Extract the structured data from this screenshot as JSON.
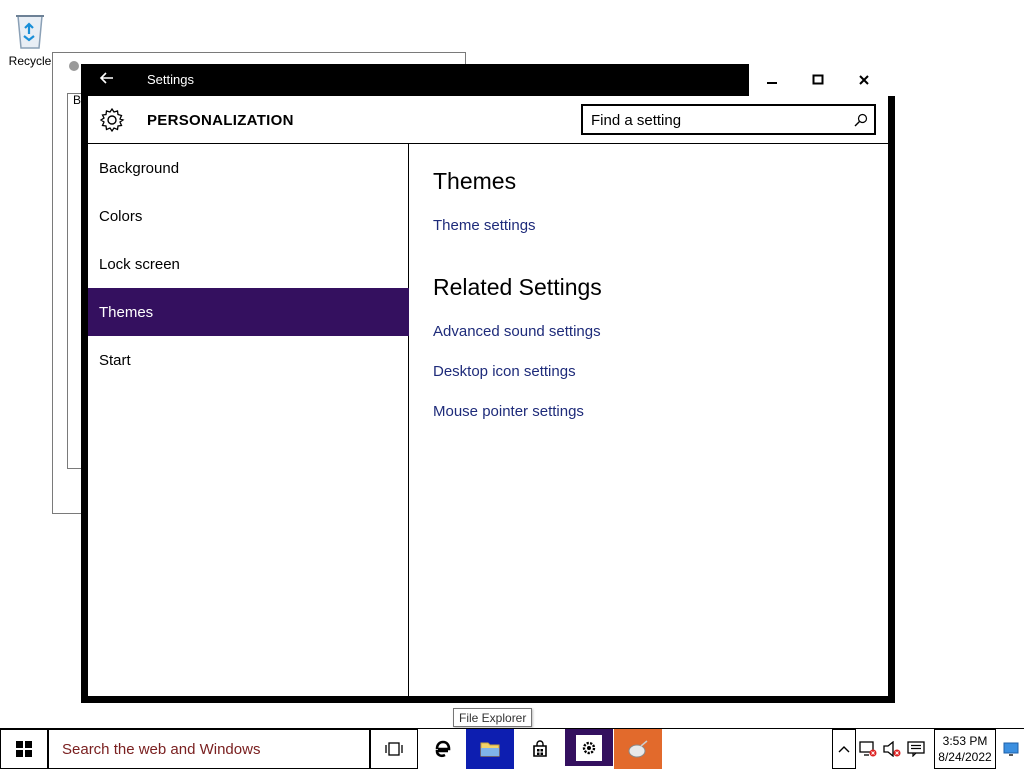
{
  "desktop": {
    "recycle_label": "Recycle",
    "bg_window_letter": "B"
  },
  "window": {
    "title": "Settings",
    "back_icon": "back-arrow-icon",
    "section_title": "PERSONALIZATION",
    "search_placeholder": "Find a setting"
  },
  "nav": {
    "items": [
      {
        "label": "Background",
        "active": false
      },
      {
        "label": "Colors",
        "active": false
      },
      {
        "label": "Lock screen",
        "active": false
      },
      {
        "label": "Themes",
        "active": true
      },
      {
        "label": "Start",
        "active": false
      }
    ]
  },
  "main": {
    "heading1": "Themes",
    "theme_settings_link": "Theme settings",
    "heading2": "Related Settings",
    "links": [
      "Advanced sound settings",
      "Desktop icon settings",
      "Mouse pointer settings"
    ]
  },
  "tooltip": "File Explorer",
  "taskbar": {
    "search_text": "Search the web and Windows",
    "time": "3:53 PM",
    "date": "8/24/2022"
  },
  "colors": {
    "accent": "#34105f",
    "link": "#1e2b7a",
    "explorer_bg": "#0d1eb0",
    "mouse_bg": "#e26a2c"
  }
}
